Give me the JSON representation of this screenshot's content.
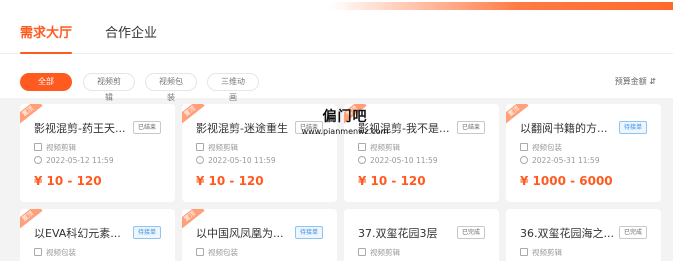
{
  "tabs": {
    "active": "需求大厅",
    "other": "合作企业"
  },
  "filters": {
    "chips": [
      "全部",
      "视频剪辑",
      "视频包装",
      "三维动画"
    ],
    "sort_label": "预算金额 ⇵"
  },
  "cards": [
    {
      "ribbon": "置顶",
      "title": "影视混剪-药王天...",
      "status": "已结束",
      "category": "视频剪辑",
      "date": "2022-05-12 11:59",
      "price": "¥ 10 - 120"
    },
    {
      "ribbon": "置顶",
      "title": "影视混剪-迷途重生",
      "status": "已结束",
      "category": "视频剪辑",
      "date": "2022-05-10 11:59",
      "price": "¥ 10 - 120"
    },
    {
      "ribbon": "置顶",
      "title": "影视混剪-我不是...",
      "status": "已结束",
      "category": "视频剪辑",
      "date": "2022-05-10 11:59",
      "price": "¥ 10 - 120"
    },
    {
      "ribbon": "置顶",
      "title": "以翻阅书籍的方...",
      "status": "待接单",
      "category": "视频包装",
      "date": "2022-05-31 11:59",
      "price": "¥ 1000 - 6000"
    },
    {
      "ribbon": "置顶",
      "title": "以EVA科幻元素...",
      "status": "待接单",
      "category": "视频包装",
      "date": "",
      "price": ""
    },
    {
      "ribbon": "置顶",
      "title": "以中国风凤凰为...",
      "status": "待接单",
      "category": "视频包装",
      "date": "",
      "price": ""
    },
    {
      "ribbon": "",
      "title": "37.双玺花园3层",
      "status": "已完成",
      "category": "视频剪辑",
      "date": "",
      "price": ""
    },
    {
      "ribbon": "",
      "title": "36.双玺花园海之...",
      "status": "已完成",
      "category": "视频剪辑",
      "date": "",
      "price": ""
    }
  ],
  "watermark": {
    "main": "偏门吧",
    "url": "www.pianmenwz.com"
  },
  "colors": {
    "accent": "#ff5a1f",
    "pending": "#3b8de0",
    "background": "#f3f3f3"
  }
}
